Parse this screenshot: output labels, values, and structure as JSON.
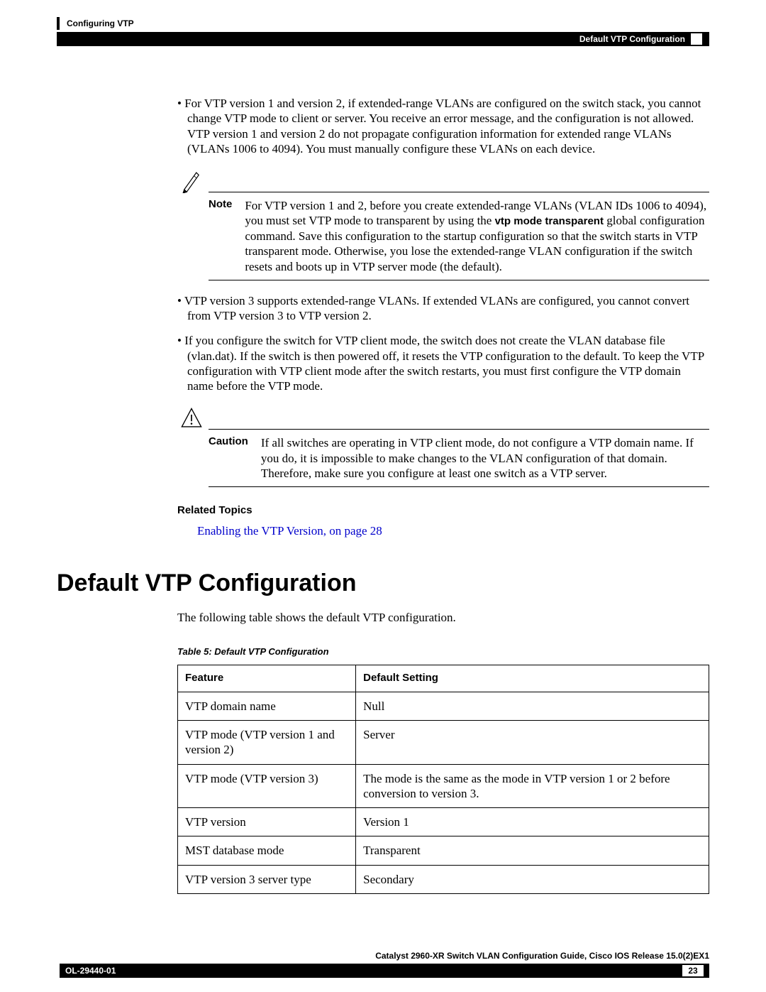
{
  "header": {
    "topTitle": "Configuring VTP",
    "rightTitle": "Default VTP Configuration"
  },
  "bullets": {
    "b1": "• For VTP version 1 and version 2, if extended-range VLANs are configured on the switch stack, you cannot change VTP mode to client or server. You receive an error message, and the configuration is not allowed. VTP version 1 and version 2 do not propagate configuration information for extended range VLANs (VLANs 1006 to 4094). You must manually configure these VLANs on each device.",
    "b2": "• VTP version 3 supports extended-range VLANs. If extended VLANs are configured, you cannot convert from VTP version 3 to VTP version 2.",
    "b3": "• If you configure the switch for VTP client mode, the switch does not create the VLAN database file (vlan.dat). If the switch is then powered off, it resets the VTP configuration to the default. To keep the VTP configuration with VTP client mode after the switch restarts, you must first configure the VTP domain name before the VTP mode."
  },
  "note": {
    "label": "Note",
    "text_a": "For VTP version 1 and 2, before you create extended-range VLANs (VLAN IDs 1006 to 4094), you must set VTP mode to transparent by using the ",
    "bold": "vtp mode transparent",
    "text_b": " global configuration command. Save this configuration to the startup configuration so that the switch starts in VTP transparent mode. Otherwise, you lose the extended-range VLAN configuration if the switch resets and boots up in VTP server mode (the default)."
  },
  "caution": {
    "label": "Caution",
    "text": "If all switches are operating in VTP client mode, do not configure a VTP domain name. If you do, it is impossible to make changes to the VLAN configuration of that domain. Therefore, make sure you configure at least one switch as a VTP server."
  },
  "related": {
    "heading": "Related Topics",
    "link": "Enabling the VTP Version,  on page 28"
  },
  "section": {
    "title": "Default VTP Configuration",
    "intro": "The following table shows the default VTP configuration.",
    "tableCaption": "Table 5: Default VTP Configuration"
  },
  "table": {
    "headers": {
      "c1": "Feature",
      "c2": "Default Setting"
    },
    "rows": [
      {
        "feature": "VTP domain name",
        "setting": "Null"
      },
      {
        "feature": "VTP mode (VTP version 1 and version 2)",
        "setting": "Server"
      },
      {
        "feature": "VTP mode (VTP version 3)",
        "setting": "The mode is the same as the mode in VTP version 1 or 2 before conversion to version 3."
      },
      {
        "feature": "VTP version",
        "setting": "Version 1"
      },
      {
        "feature": "MST database mode",
        "setting": "Transparent"
      },
      {
        "feature": "VTP version 3 server type",
        "setting": "Secondary"
      }
    ]
  },
  "footer": {
    "guide": "Catalyst 2960-XR Switch VLAN Configuration Guide, Cisco IOS Release 15.0(2)EX1",
    "doc": "OL-29440-01",
    "page": "23"
  }
}
